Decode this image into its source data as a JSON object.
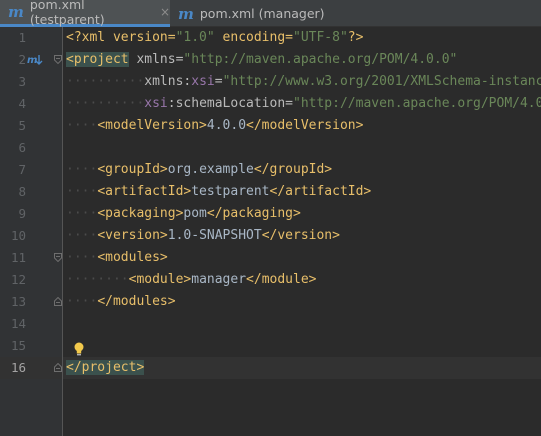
{
  "tabs": [
    {
      "label": "pom.xml (testparent)",
      "close": "×",
      "active": true
    },
    {
      "label": "pom.xml (manager)",
      "close": "",
      "active": false
    }
  ],
  "line_numbers": [
    "1",
    "2",
    "3",
    "4",
    "5",
    "6",
    "7",
    "8",
    "9",
    "10",
    "11",
    "12",
    "13",
    "14",
    "15",
    "16"
  ],
  "current_line": "16",
  "code": {
    "l1": {
      "p1": "<?xml version=",
      "v1": "\"1.0\"",
      "p2": " encoding=",
      "v2": "\"UTF-8\"",
      "p3": "?>"
    },
    "l2": {
      "tag": "<project",
      "attr": " xmlns=",
      "val": "\"http://maven.apache.org/POM/4.0.0\""
    },
    "l3": {
      "ws": "··········",
      "attr": "xmlns:",
      "ns": "xsi",
      "eq": "=",
      "val": "\"http://www.w3.org/2001/XMLSchema-instanc"
    },
    "l4": {
      "ws": "··········",
      "ns": "xsi",
      "attr": ":schemaLocation=",
      "val": "\"http://maven.apache.org/POM/4.0"
    },
    "l5": {
      "ws": "····",
      "open": "<modelVersion>",
      "text": "4.0.0",
      "close": "</modelVersion>"
    },
    "l7": {
      "ws": "····",
      "open": "<groupId>",
      "text": "org.example",
      "close": "</groupId>"
    },
    "l8": {
      "ws": "····",
      "open": "<artifactId>",
      "text": "testparent",
      "close": "</artifactId>"
    },
    "l9": {
      "ws": "····",
      "open": "<packaging>",
      "text": "pom",
      "close": "</packaging>"
    },
    "l10": {
      "ws": "····",
      "open": "<version>",
      "text": "1.0-SNAPSHOT",
      "close": "</version>"
    },
    "l11": {
      "ws": "····",
      "open": "<modules>"
    },
    "l12": {
      "ws": "········",
      "open": "<module>",
      "text": "manager",
      "close": "</module>"
    },
    "l13": {
      "ws": "····",
      "close": "</modules>"
    },
    "l16": {
      "close": "</project>"
    }
  },
  "icons": {
    "maven_gutter": "maven-run-icon",
    "intention": "lightbulb-icon",
    "tab_file": "maven-m-icon"
  },
  "colors": {
    "tag": "#e8bf6a",
    "string": "#6a8759",
    "namespace": "#9876aa",
    "tab_accent": "#4a88c7"
  }
}
